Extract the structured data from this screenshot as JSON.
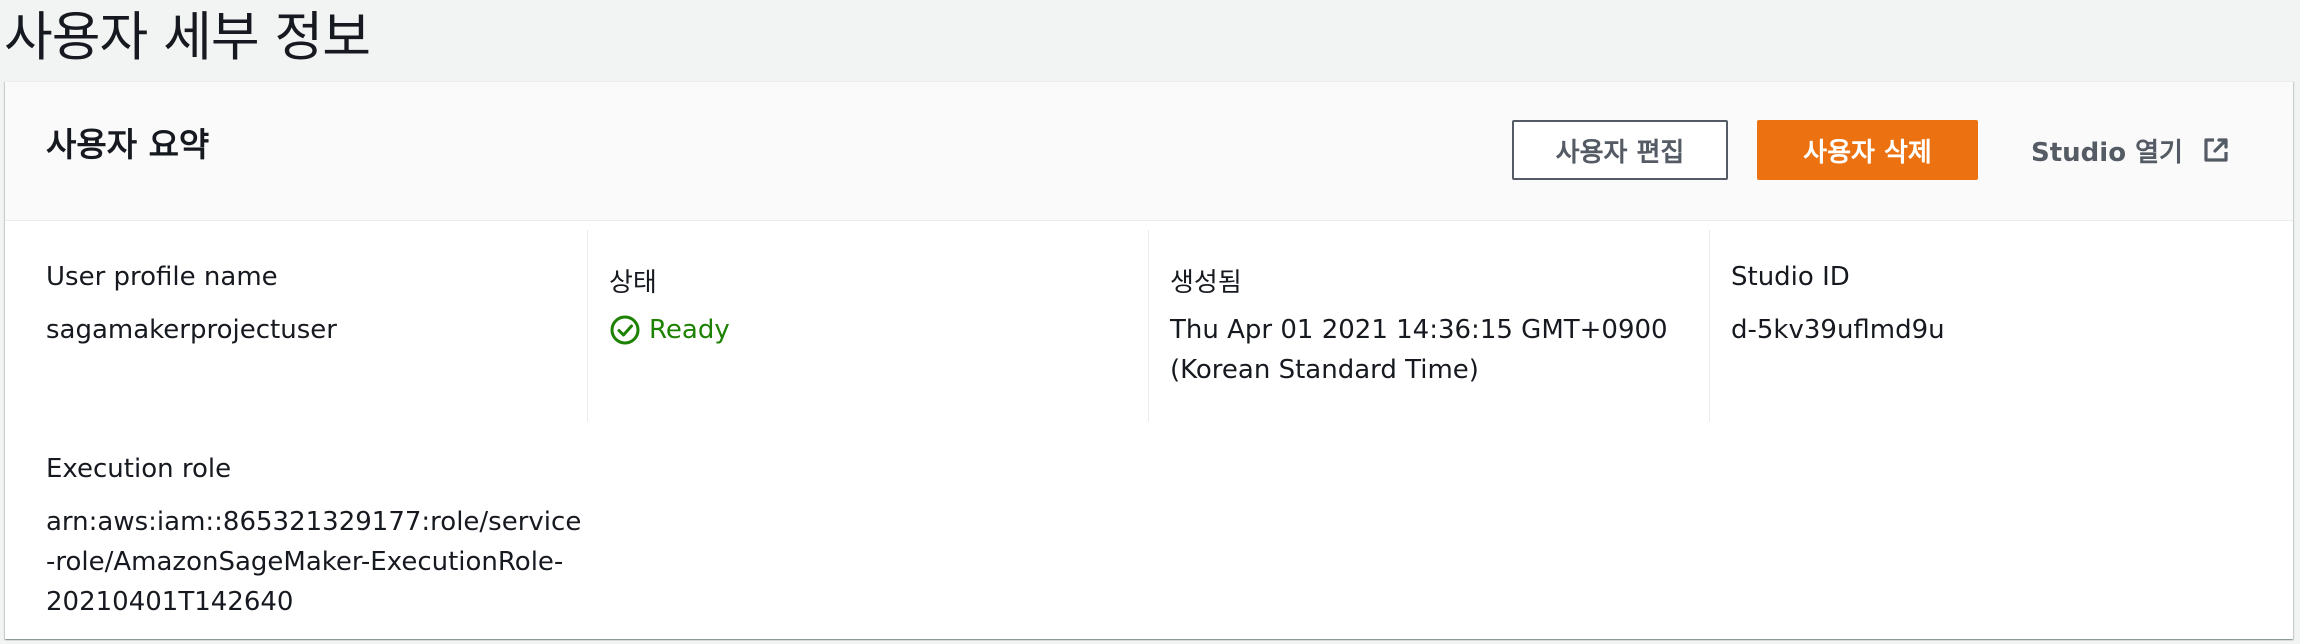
{
  "page": {
    "title": "사용자 세부 정보"
  },
  "summary": {
    "title": "사용자 요약",
    "buttons": {
      "edit": "사용자 편집",
      "delete": "사용자 삭제",
      "studio": "Studio 열기",
      "studio_icon": "external-link-icon"
    },
    "fields": {
      "profile_name": {
        "label": "User profile name",
        "value": "sagamakerprojectuser"
      },
      "status": {
        "label": "상태",
        "value": "Ready",
        "icon": "check-circle-icon",
        "color": "#1d8102"
      },
      "created": {
        "label": "생성됨",
        "value_line1": "Thu Apr 01 2021 14:36:15 GMT+0900",
        "value_line2": "(Korean Standard Time)"
      },
      "studio_id": {
        "label": "Studio ID",
        "value": "d-5kv39uflmd9u"
      },
      "execution_role": {
        "label": "Execution role",
        "value_line1": "arn:aws:iam::865321329177:role/service",
        "value_line2": "-role/AmazonSageMaker-ExecutionRole-",
        "value_line3": "20210401T142640"
      }
    }
  },
  "colors": {
    "accent": "#ec7211",
    "success": "#1d8102",
    "text": "#16191f",
    "secondary": "#545b64"
  }
}
